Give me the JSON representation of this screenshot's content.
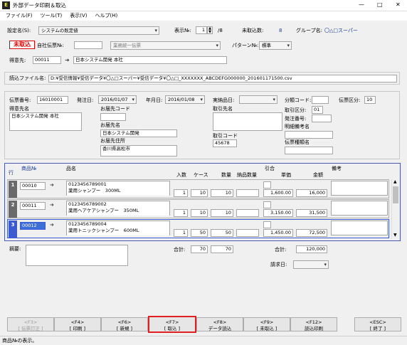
{
  "window": {
    "title": "外部データ印刷＆取込",
    "app_icon": "E"
  },
  "menu": [
    "ファイル(F)",
    "ツール(T)",
    "表示(V)",
    "ヘルプ(H)"
  ],
  "top": {
    "settings_label": "設定名(S):",
    "settings_value": "システムの既定値",
    "display_label": "表示№:",
    "display_value": "1",
    "display_total": "/8",
    "unimported_label": "未取込数:",
    "unimported_value": "8",
    "group_label": "グループ名:",
    "group_value": "〇△□スーパー",
    "status_badge": "未取込",
    "own_slip_label": "自社伝票№:",
    "own_slip_value": "",
    "business_value": "業務統一伝票",
    "pattern_label": "パターン№:",
    "pattern_value": "標準",
    "customer_label": "得意先:",
    "customer_code": "00011",
    "customer_name": "日本システム開発 本社"
  },
  "file": {
    "label": "読込ファイル名:",
    "path": "D:¥受信情報¥受信データ¥〇△□スーパー¥受信データ¥〇△□_XXXXXXX_ABCDEFG000000_201601171500.csv"
  },
  "header": {
    "slip_no_label": "伝票番号:",
    "slip_no": "16010001",
    "order_date_label": "発注日:",
    "order_date": "2016/01/07",
    "due_date_label": "年月日:",
    "due_date": "2016/01/08",
    "actual_label": "実納品日:",
    "actual": "",
    "cls_code_label": "分類コード:",
    "cls_code": "",
    "slip_type_label": "伝票区分:",
    "slip_type": "10",
    "customer_name_label": "得意先名",
    "customer_name": "日本システム開発 本社",
    "delivery_code_label": "お届先コード",
    "delivery_code": "",
    "delivery_name_label": "お届先名",
    "delivery_name": "日本システム開発",
    "delivery_addr_label": "お届先住所",
    "delivery_addr": "香川県高松市",
    "account_name_label": "取引先名",
    "account_name": "",
    "account_code_label": "取引コード",
    "account_code": "45678",
    "trade_type_label": "取引区分:",
    "trade_type": "01",
    "order_no_label": "発注番号:",
    "order_no": "",
    "detail_remark_label": "明細備考名",
    "detail_remark": "",
    "slip_kind_label": "伝票種類名",
    "slip_kind": ""
  },
  "grid": {
    "col_row": "行",
    "col_code": "商品№",
    "col_name": "品名",
    "col_irisu": "入数",
    "col_case": "ケース",
    "col_qty": "数量",
    "col_dqty": "納品数量",
    "col_hikiate": "引合",
    "col_price": "単価",
    "col_amount": "金額",
    "col_note": "備考",
    "rows": [
      {
        "no": "1",
        "code": "00010",
        "jan": "0123456789001",
        "name": "薬用シャンプー　300ML",
        "irisu": "1",
        "case": "10",
        "qty": "10",
        "dqty": "",
        "price": "1,600.00",
        "amount": "16,000"
      },
      {
        "no": "2",
        "code": "00011",
        "jan": "0123456789002",
        "name": "薬用ヘアケアシャンプー　350ML",
        "irisu": "1",
        "case": "10",
        "qty": "10",
        "dqty": "",
        "price": "3,150.00",
        "amount": "31,500"
      },
      {
        "no": "3",
        "code": "00012",
        "jan": "0123456789004",
        "name": "薬用トニックシャンプー　600ML",
        "irisu": "1",
        "case": "50",
        "qty": "50",
        "dqty": "",
        "price": "1,450.00",
        "amount": "72,500"
      }
    ]
  },
  "footer": {
    "remarks_label": "摘要:",
    "total_label": "合計:",
    "total_case": "70",
    "total_qty": "70",
    "total2_label": "合計:",
    "total_amount": "120,000",
    "billing_label": "請求日:",
    "billing_value": ""
  },
  "fkeys": [
    {
      "key": "<F3>",
      "label": "[ 伝票訂正 ]"
    },
    {
      "key": "<F4>",
      "label": "[ 印刷 ]"
    },
    {
      "key": "<F6>",
      "label": "[ 新規 ]"
    },
    {
      "key": "<F7>",
      "label": "[ 取込 ]"
    },
    {
      "key": "<F8>",
      "label": "データ読込"
    },
    {
      "key": "<F9>",
      "label": "[ 未取込 ]"
    },
    {
      "key": "<F12>",
      "label": "読込印刷"
    },
    {
      "key": "<ESC>",
      "label": "[ 終了 ]"
    }
  ],
  "status": "商品№の表示。",
  "window_controls": {
    "minimize": "—",
    "maximize": "□",
    "close": "✕"
  }
}
